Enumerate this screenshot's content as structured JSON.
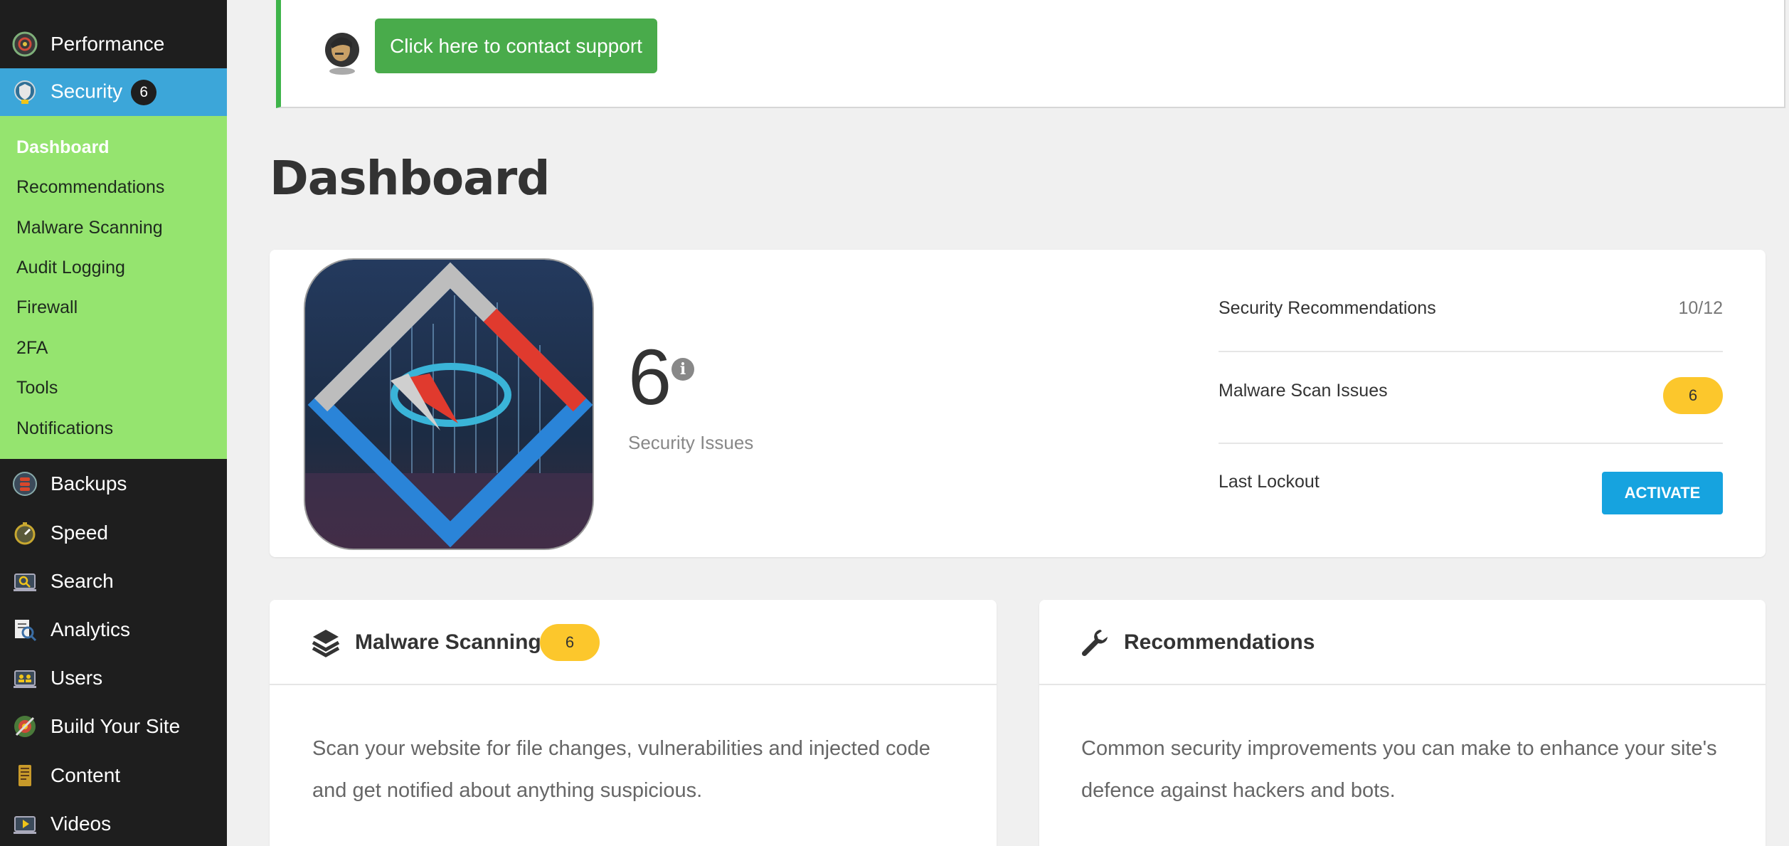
{
  "sidebar": {
    "top_items": [
      {
        "label": "Performance",
        "icon": "performance-icon"
      },
      {
        "label": "Security",
        "icon": "security-icon",
        "badge": "6"
      }
    ],
    "submenu": [
      "Dashboard",
      "Recommendations",
      "Malware Scanning",
      "Audit Logging",
      "Firewall",
      "2FA",
      "Tools",
      "Notifications"
    ],
    "bottom_items": [
      {
        "label": "Backups",
        "icon": "backups-icon"
      },
      {
        "label": "Speed",
        "icon": "speed-icon"
      },
      {
        "label": "Search",
        "icon": "search-icon"
      },
      {
        "label": "Analytics",
        "icon": "analytics-icon"
      },
      {
        "label": "Users",
        "icon": "users-icon"
      },
      {
        "label": "Build Your Site",
        "icon": "build-site-icon"
      },
      {
        "label": "Content",
        "icon": "content-icon"
      },
      {
        "label": "Videos",
        "icon": "videos-icon"
      }
    ]
  },
  "notice": {
    "button_label": "Click here to contact support"
  },
  "page": {
    "title": "Dashboard"
  },
  "summary": {
    "issues_count": "6",
    "issues_label": "Security Issues",
    "stats": [
      {
        "label": "Security Recommendations",
        "value": "10/12"
      },
      {
        "label": "Malware Scan Issues",
        "value": "6"
      },
      {
        "label": "Last Lockout",
        "value": "ACTIVATE"
      }
    ]
  },
  "cards": {
    "malware": {
      "title": "Malware Scanning",
      "badge": "6",
      "line1": "Scan your website for file changes, vulnerabilities and injected code",
      "line2": "and get notified about anything suspicious."
    },
    "recommendations": {
      "title": "Recommendations",
      "line1": "Common security improvements you can make to enhance your site's",
      "line2": "defence against hackers and bots."
    }
  },
  "colors": {
    "sidebar_bg": "#1e1e1e",
    "active_item": "#3ca6d9",
    "submenu_bg": "#95e46f",
    "support_button": "#49ab4b",
    "badge_yellow": "#fcc72c",
    "activate_blue": "#16a3df"
  }
}
